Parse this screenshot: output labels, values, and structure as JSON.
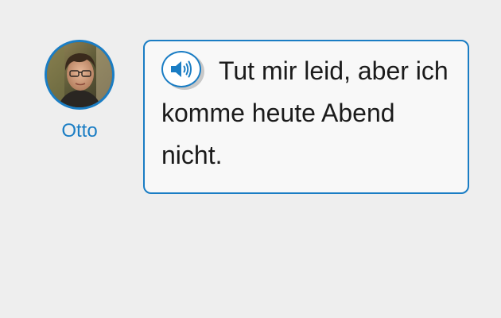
{
  "speaker": {
    "name": "Otto"
  },
  "message": {
    "text": "Tut mir leid, aber ich komme heute Abend nicht."
  },
  "audio_button": {
    "icon": "speaker-volume-icon"
  },
  "colors": {
    "accent": "#1a7dc4",
    "background": "#eeeeee",
    "bubble_background": "#f8f8f8",
    "text": "#1b1b1b"
  }
}
